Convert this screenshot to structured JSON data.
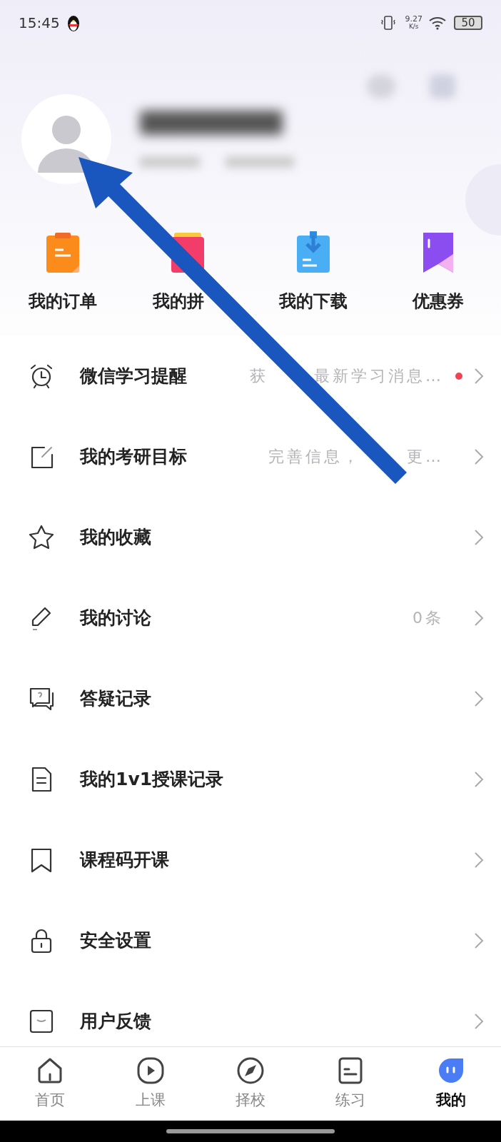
{
  "status_bar": {
    "time": "15:45",
    "speed": "9.27",
    "speed_unit": "K/s",
    "battery": "50"
  },
  "quick_actions": [
    {
      "label": "我的订单"
    },
    {
      "label": "我的拼"
    },
    {
      "label": "我的下载"
    },
    {
      "label": "优惠券"
    }
  ],
  "menu": [
    {
      "label": "微信学习提醒",
      "hint": [
        "获",
        "最新学习消息…"
      ],
      "unread": true
    },
    {
      "label": "我的考研目标",
      "hint": [
        "完善信息，",
        "更…"
      ],
      "unread": false
    },
    {
      "label": "我的收藏",
      "unread": false
    },
    {
      "label": "我的讨论",
      "hint": [
        "0条"
      ],
      "unread": false
    },
    {
      "label": "答疑记录",
      "unread": false
    },
    {
      "label": "我的1v1授课记录",
      "unread": false
    },
    {
      "label": "课程码开课",
      "unread": false
    },
    {
      "label": "安全设置",
      "unread": false
    },
    {
      "label": "用户反馈",
      "unread": false
    }
  ],
  "tab_bar": [
    {
      "label": "首页",
      "selected": false
    },
    {
      "label": "上课",
      "selected": false
    },
    {
      "label": "择校",
      "selected": false
    },
    {
      "label": "练习",
      "selected": false
    },
    {
      "label": "我的",
      "selected": true
    }
  ]
}
